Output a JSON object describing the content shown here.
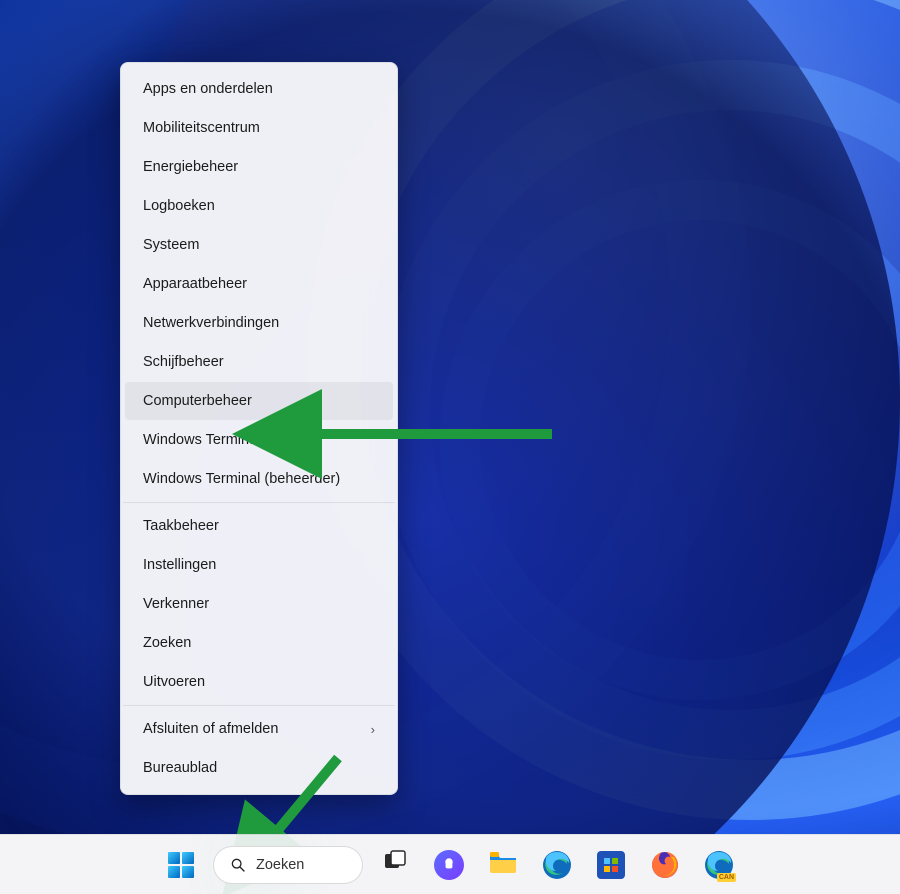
{
  "menu": {
    "groups": [
      [
        {
          "key": "apps-features",
          "label": "Apps en onderdelen"
        },
        {
          "key": "mobility-center",
          "label": "Mobiliteitscentrum"
        },
        {
          "key": "power-options",
          "label": "Energiebeheer"
        },
        {
          "key": "event-viewer",
          "label": "Logboeken"
        },
        {
          "key": "system",
          "label": "Systeem"
        },
        {
          "key": "device-manager",
          "label": "Apparaatbeheer"
        },
        {
          "key": "network-connections",
          "label": "Netwerkverbindingen"
        },
        {
          "key": "disk-management",
          "label": "Schijfbeheer"
        },
        {
          "key": "computer-management",
          "label": "Computerbeheer",
          "highlight": true
        },
        {
          "key": "windows-terminal",
          "label": "Windows Terminal"
        },
        {
          "key": "windows-terminal-admin",
          "label": "Windows Terminal (beheerder)"
        }
      ],
      [
        {
          "key": "task-manager",
          "label": "Taakbeheer"
        },
        {
          "key": "settings",
          "label": "Instellingen"
        },
        {
          "key": "file-explorer",
          "label": "Verkenner"
        },
        {
          "key": "search",
          "label": "Zoeken"
        },
        {
          "key": "run",
          "label": "Uitvoeren"
        }
      ],
      [
        {
          "key": "shutdown-signout",
          "label": "Afsluiten of afmelden",
          "submenu": true
        },
        {
          "key": "desktop",
          "label": "Bureaublad"
        }
      ]
    ]
  },
  "taskbar": {
    "search_placeholder": "Zoeken"
  },
  "colors": {
    "annotation": "#1f9a3d"
  }
}
